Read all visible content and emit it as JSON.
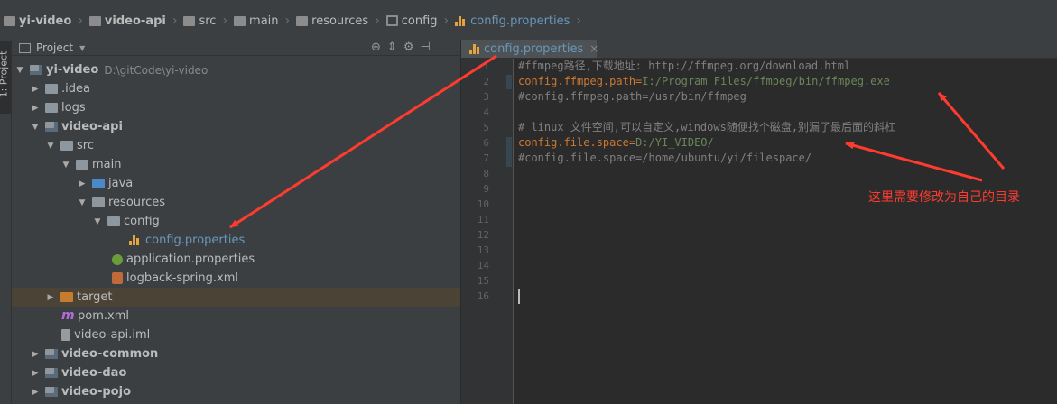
{
  "navbar": {
    "crumbs": [
      {
        "label": "yi-video",
        "icon": "module-icon"
      },
      {
        "label": "video-api",
        "icon": "module-icon"
      },
      {
        "label": "src",
        "icon": "folder-icon"
      },
      {
        "label": "main",
        "icon": "folder-icon"
      },
      {
        "label": "resources",
        "icon": "resources-folder-icon"
      },
      {
        "label": "config",
        "icon": "package-icon"
      },
      {
        "label": "config.properties",
        "icon": "properties-file-icon"
      }
    ]
  },
  "left_toolwindow": {
    "label": "1: Project"
  },
  "project_panel": {
    "title": "Project",
    "tree": [
      {
        "label": "yi-video",
        "path": "D:\\gitCode\\yi-video"
      },
      {
        "label": ".idea"
      },
      {
        "label": "logs"
      },
      {
        "label": "video-api"
      },
      {
        "label": "src"
      },
      {
        "label": "main"
      },
      {
        "label": "java"
      },
      {
        "label": "resources"
      },
      {
        "label": "config"
      },
      {
        "label": "config.properties"
      },
      {
        "label": "application.properties"
      },
      {
        "label": "logback-spring.xml"
      },
      {
        "label": "target"
      },
      {
        "label": "pom.xml"
      },
      {
        "label": "video-api.iml"
      },
      {
        "label": "video-common"
      },
      {
        "label": "video-dao"
      },
      {
        "label": "video-pojo"
      }
    ]
  },
  "editor": {
    "tab": {
      "label": "config.properties",
      "close": "×"
    },
    "line_numbers": [
      "1",
      "2",
      "3",
      "4",
      "5",
      "6",
      "7",
      "8",
      "9",
      "10",
      "11",
      "12",
      "13",
      "14",
      "15",
      "16"
    ],
    "lines": [
      {
        "comment": "#ffmpeg路径,下载地址: http://ffmpeg.org/download.html"
      },
      {
        "key": "config.ffmpeg.path",
        "eq": "=",
        "value": "I:/Program Files/ffmpeg/bin/ffmpeg.exe"
      },
      {
        "comment": "#config.ffmpeg.path=/usr/bin/ffmpeg"
      },
      {
        "comment": ""
      },
      {
        "comment": "# linux 文件空间,可以自定义,windows随便找个磁盘,别漏了最后面的斜杠"
      },
      {
        "key": "config.file.space",
        "eq": "=",
        "value": "D:/YI_VIDEO/"
      },
      {
        "comment": "#config.file.space=/home/ubuntu/yi/filespace/"
      }
    ]
  },
  "annotation": {
    "text": "这里需要修改为自己的目录",
    "color": "#ff3b30"
  },
  "colors": {
    "comment": "#808080",
    "key": "#cc7832",
    "value": "#6a8759",
    "link": "#6897bb"
  }
}
